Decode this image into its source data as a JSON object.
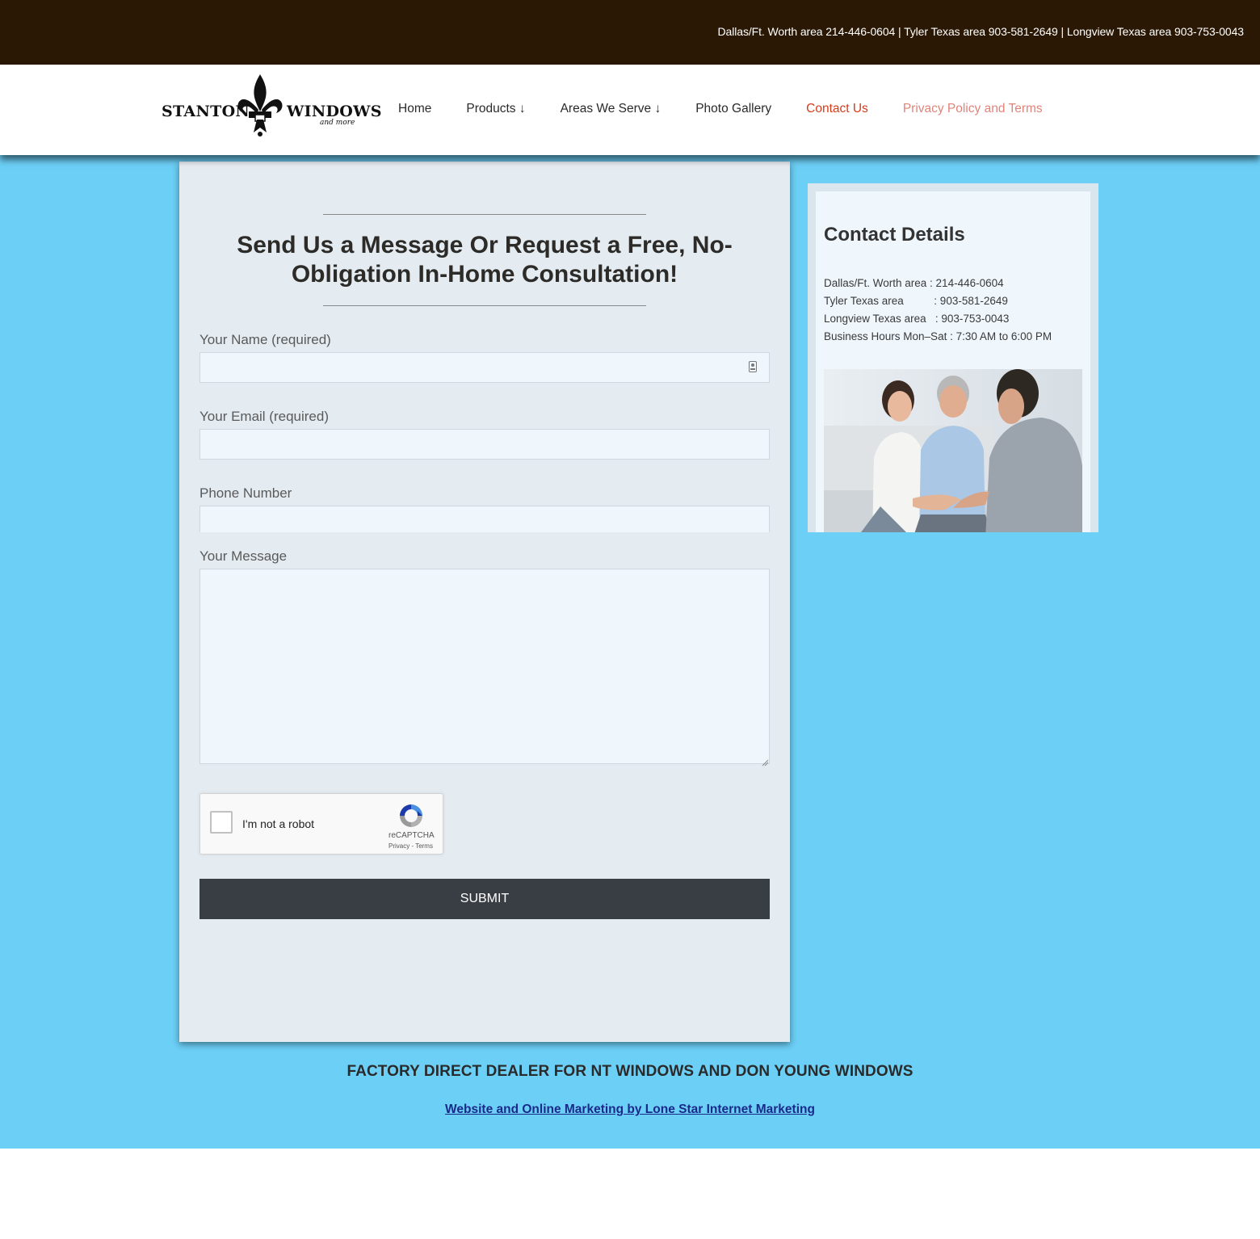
{
  "topbar": {
    "phones": "Dallas/Ft. Worth area 214-446-0604 | Tyler Texas area 903-581-2649 | Longview Texas area 903-753-0043"
  },
  "header": {
    "logo": {
      "word1": "STANTON",
      "word2": "WINDOWS",
      "tagline": "and more"
    },
    "nav": [
      {
        "label": "Home"
      },
      {
        "label": "Products ↓"
      },
      {
        "label": "Areas We Serve ↓"
      },
      {
        "label": "Photo Gallery"
      },
      {
        "label": "Contact Us"
      },
      {
        "label": "Privacy Policy and Terms"
      }
    ]
  },
  "form": {
    "title": "Send Us a Message Or Request a Free, No-Obligation In-Home Consultation!",
    "name_label": "Your Name (required)",
    "name_value": "",
    "email_label": "Your Email (required)",
    "email_value": "",
    "phone_label": "Phone Number",
    "phone_value": "",
    "message_label": "Your Message",
    "message_value": "",
    "captcha": {
      "label": "I'm not a robot",
      "brand": "reCAPTCHA",
      "links": "Privacy - Terms"
    },
    "submit_label": "SUBMIT"
  },
  "contact_details": {
    "title": "Contact Details",
    "lines": [
      "Dallas/Ft. Worth area : 214-446-0604",
      "Tyler Texas area          : 903-581-2649",
      "Longview Texas area   : 903-753-0043",
      "Business Hours Mon–Sat : 7:30 AM to 6:00 PM"
    ]
  },
  "footer": {
    "dealer_line": "FACTORY DIRECT DEALER FOR NT WINDOWS AND DON YOUNG WINDOWS",
    "credit_link": "Website and Online Marketing by Lone Star Internet Marketing"
  },
  "colors": {
    "topbar": "#2a1804",
    "page_blue": "#6ccff6",
    "active_nav": "#d43c1c",
    "submit_bg": "#393e45"
  }
}
